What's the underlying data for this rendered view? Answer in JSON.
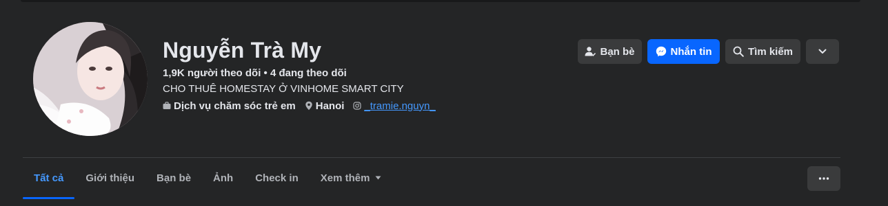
{
  "profile": {
    "name": "Nguyễn Trà My",
    "followers": "1,9K người theo dõi",
    "separator": "•",
    "following": "4 đang theo dõi",
    "bio": "CHO THUÊ HOMESTAY Ở VINHOME SMART CITY",
    "details": {
      "work": "Dịch vụ chăm sóc trẻ em",
      "location": "Hanoi",
      "instagram": "_tramie.nguyn_"
    }
  },
  "actions": {
    "friends": "Bạn bè",
    "message": "Nhắn tin",
    "search": "Tìm kiếm"
  },
  "tabs": [
    {
      "label": "Tất cả",
      "active": true
    },
    {
      "label": "Giới thiệu"
    },
    {
      "label": "Bạn bè"
    },
    {
      "label": "Ảnh"
    },
    {
      "label": "Check in"
    },
    {
      "label": "Xem thêm"
    }
  ],
  "colors": {
    "background": "#242526",
    "accent": "#0866ff",
    "link": "#4599ff",
    "button": "#3a3b3c",
    "text": "#e4e6eb",
    "muted": "#b0b3b8"
  }
}
